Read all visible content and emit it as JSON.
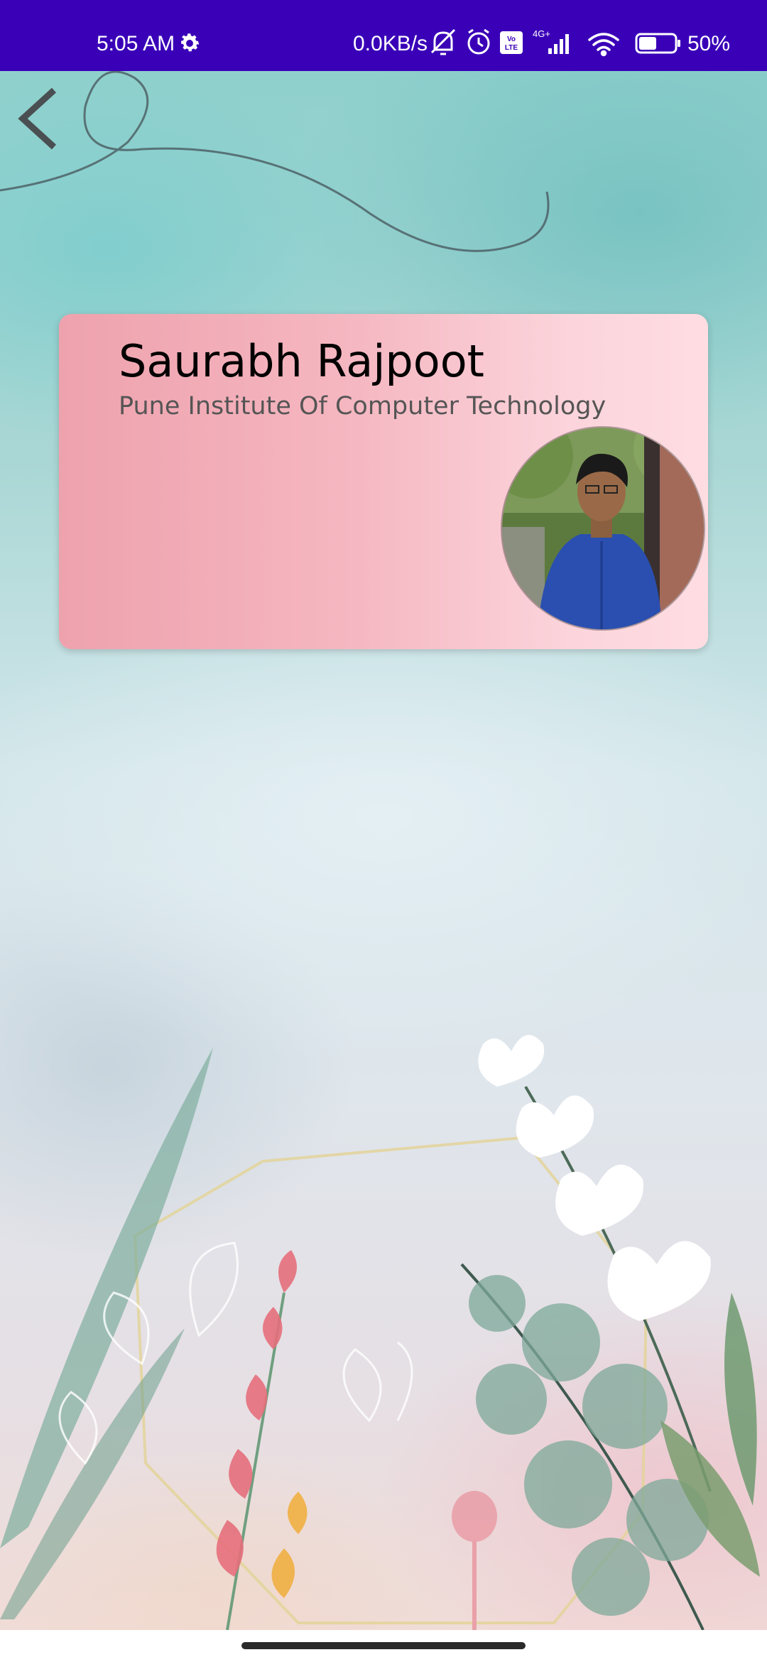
{
  "status_bar": {
    "time": "5:05 AM",
    "network_speed": "0.0KB/s",
    "battery_percent": "50%",
    "icons": [
      "settings-icon",
      "mute-icon",
      "alarm-icon",
      "volte-icon",
      "signal-4g-icon",
      "wifi-icon",
      "battery-icon"
    ],
    "volte_label": "Vo LTE",
    "network_type": "4G+"
  },
  "navigation": {
    "back_icon": "chevron-left-icon"
  },
  "profile": {
    "name": "Saurabh Rajpoot",
    "institute": "Pune Institute Of Computer Technology",
    "card_gradient": [
      "#eea2ad",
      "#fedde2"
    ]
  },
  "colors": {
    "status_bar": "#3a00b8",
    "name_text": "#000000",
    "institute_text": "#555555"
  }
}
